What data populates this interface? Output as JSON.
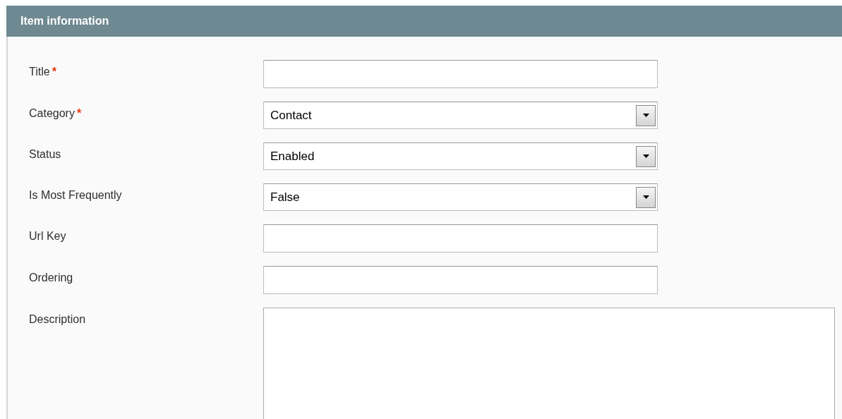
{
  "panel": {
    "title": "Item information"
  },
  "fields": [
    {
      "label": "Title",
      "required_mark": "*",
      "kind": "text"
    },
    {
      "label": "Category",
      "required_mark": "*",
      "kind": "select",
      "value": "Contact"
    },
    {
      "label": "Status",
      "kind": "select",
      "value": "Enabled"
    },
    {
      "label": "Is Most Frequently",
      "kind": "select",
      "value": "False"
    },
    {
      "label": "Url Key",
      "kind": "text"
    },
    {
      "label": "Ordering",
      "kind": "text"
    },
    {
      "label": "Description",
      "kind": "textarea"
    }
  ]
}
